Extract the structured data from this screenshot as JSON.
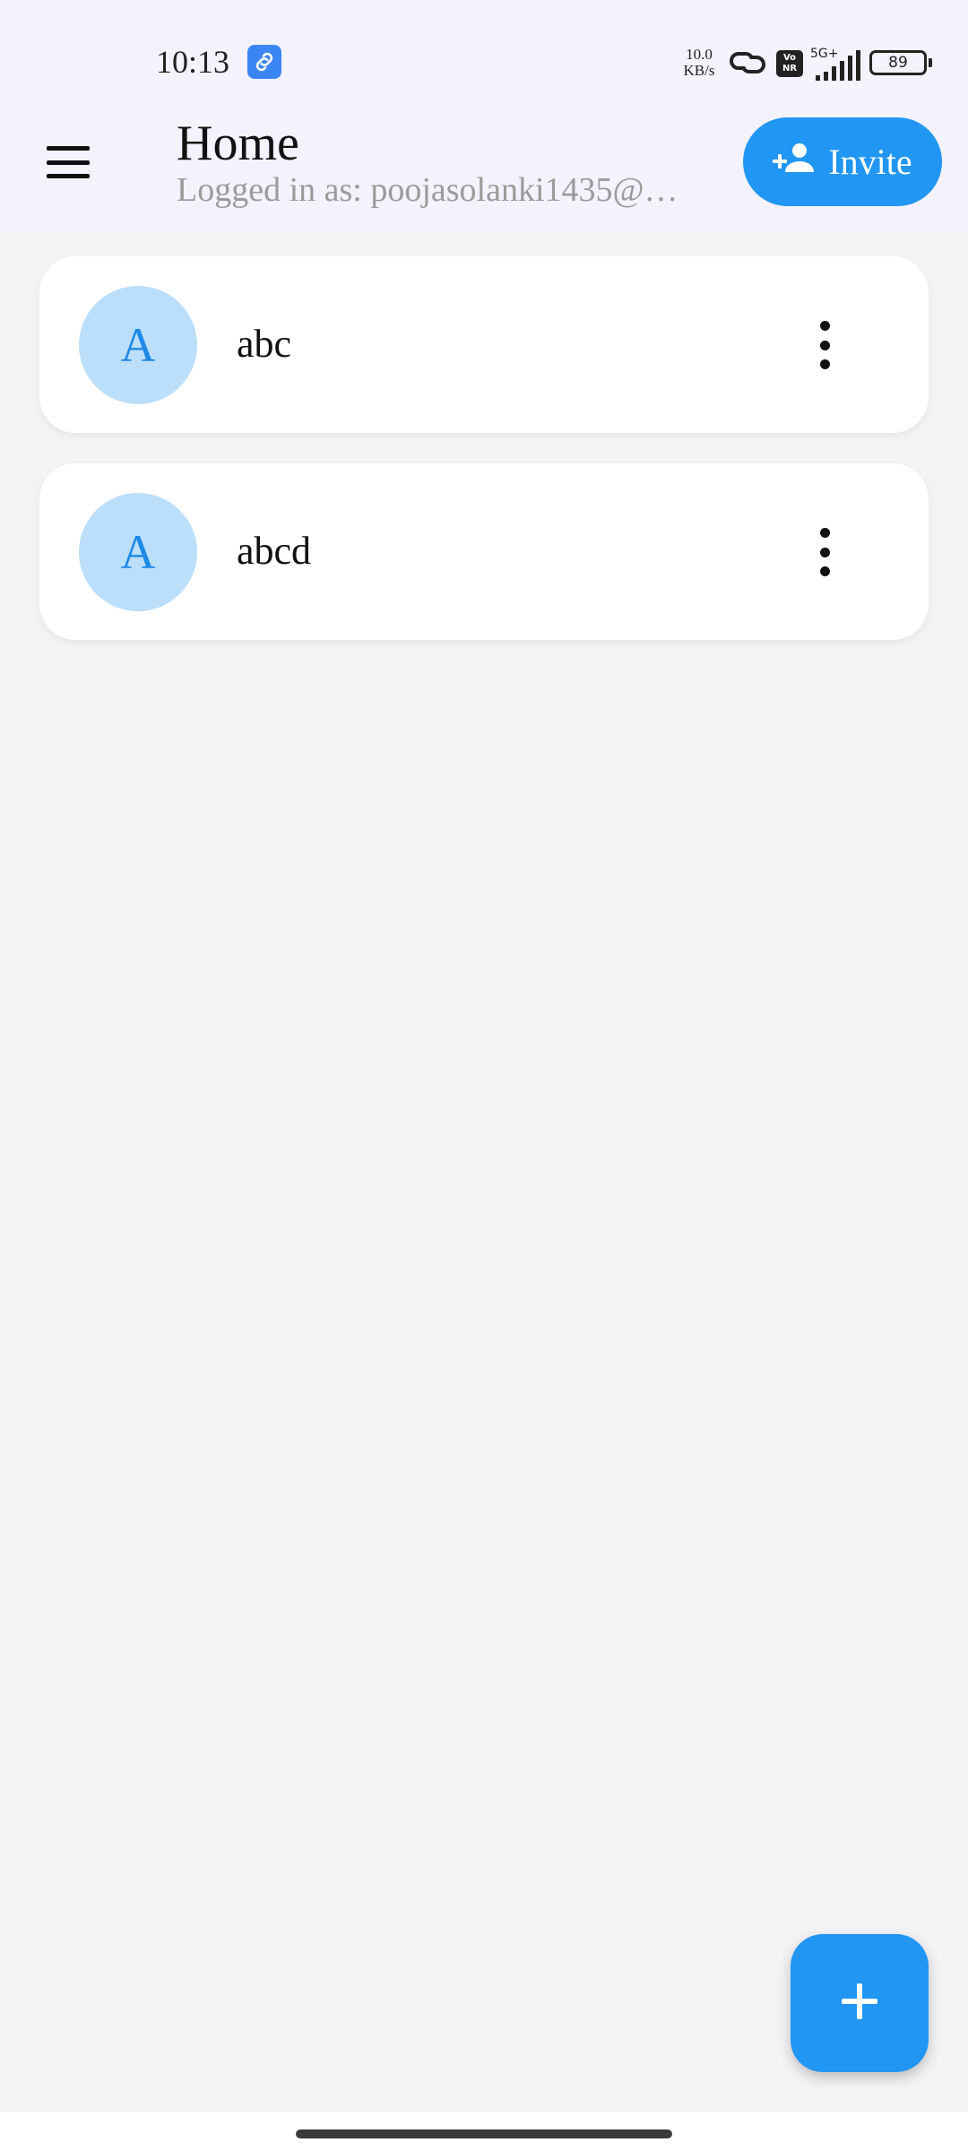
{
  "status_bar": {
    "time": "10:13",
    "net_speed_value": "10.0",
    "net_speed_unit": "KB/s",
    "vonr": "Vo NR",
    "network": "5G+",
    "battery": "89"
  },
  "header": {
    "title": "Home",
    "subtitle": "Logged in as: poojasolanki1435@…",
    "invite_label": "Invite"
  },
  "items": [
    {
      "initial": "A",
      "name": "abc"
    },
    {
      "initial": "A",
      "name": "abcd"
    }
  ],
  "colors": {
    "accent": "#2196f3",
    "avatar_bg": "#bbdefb",
    "header_bg": "#f4f2fd",
    "page_bg": "#f3f3f5"
  }
}
